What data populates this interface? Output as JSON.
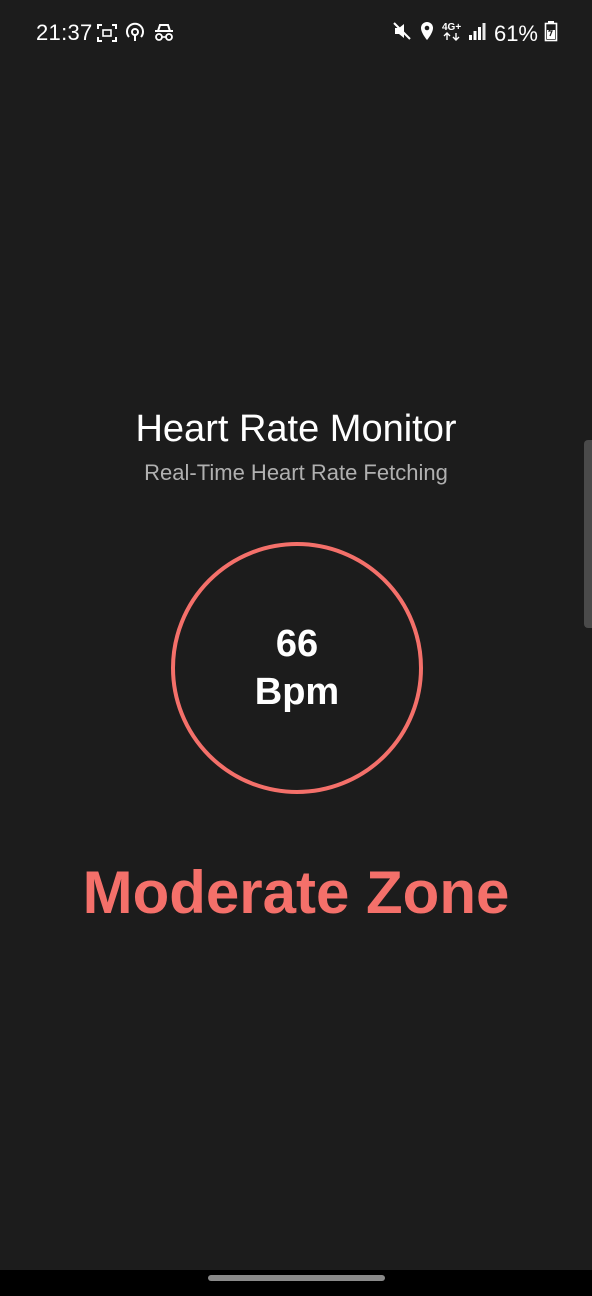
{
  "status_bar": {
    "time": "21:37",
    "battery": "61%",
    "network": "4G+",
    "left_icons": [
      "screenshot-icon",
      "location-sharing-icon",
      "incognito-icon"
    ],
    "right_icons": [
      "mute-icon",
      "location-icon",
      "network-icon",
      "signal-icon",
      "battery-icon"
    ]
  },
  "header": {
    "title": "Heart Rate Monitor",
    "subtitle": "Real-Time Heart Rate Fetching"
  },
  "monitor": {
    "bpm_value": "66",
    "bpm_unit": "Bpm",
    "zone": "Moderate Zone"
  },
  "colors": {
    "accent": "#f4706a",
    "background": "#1c1c1c",
    "text": "#ffffff",
    "subtext": "#b0b0b0"
  }
}
